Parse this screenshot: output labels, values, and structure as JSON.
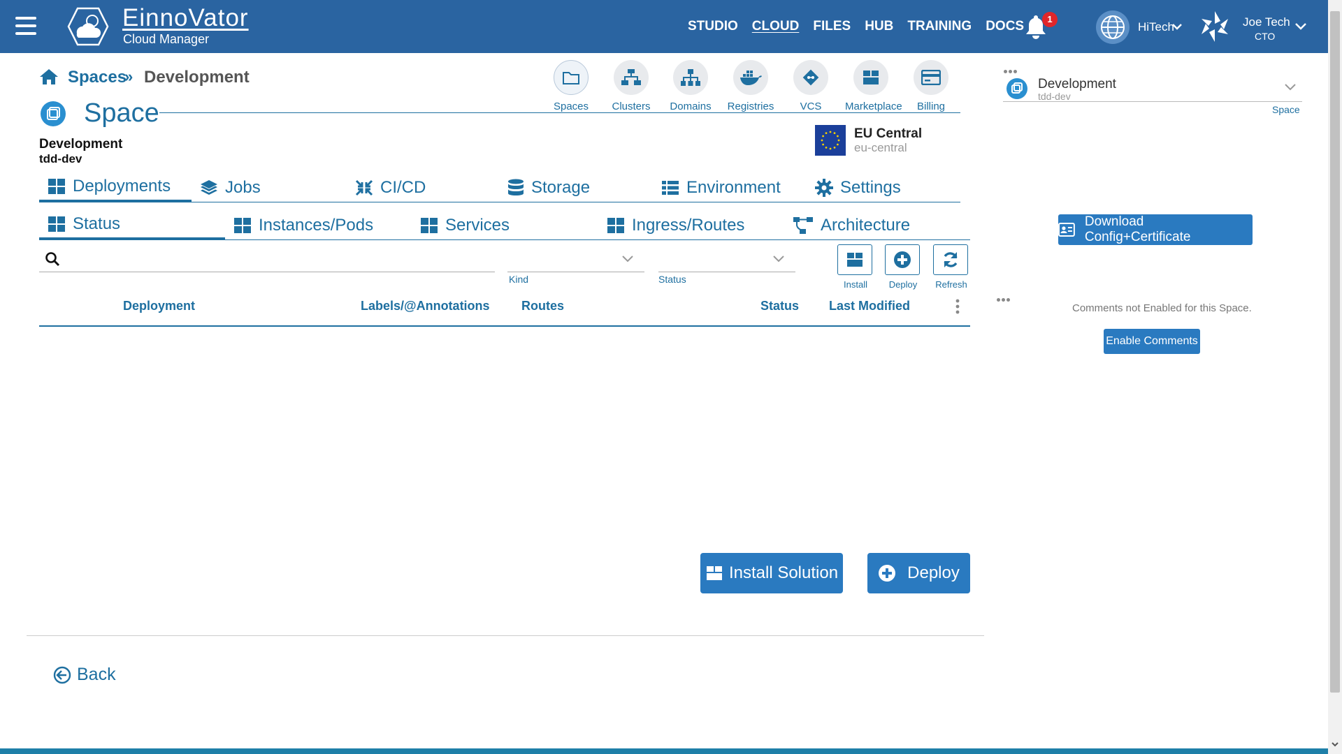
{
  "header": {
    "app_title": "EinnoVator",
    "app_subtitle": "Cloud Manager",
    "nav": [
      "STUDIO",
      "CLOUD",
      "FILES",
      "HUB",
      "TRAINING",
      "DOCS"
    ],
    "notification_count": "1",
    "org_name": "HiTech",
    "user_name": "Joe Tech",
    "user_role": "CTO"
  },
  "breadcrumb": {
    "root": "Spaces",
    "separator": "»",
    "current": "Development"
  },
  "page": {
    "title": "Space",
    "space_name": "Development",
    "space_id": "tdd-dev"
  },
  "quick_nav": [
    "Spaces",
    "Clusters",
    "Domains",
    "Registries",
    "VCS",
    "Marketplace",
    "Billing"
  ],
  "region": {
    "name": "EU Central",
    "code": "eu-central"
  },
  "main_tabs": [
    "Deployments",
    "Jobs",
    "CI/CD",
    "Storage",
    "Environment",
    "Settings"
  ],
  "sub_tabs": [
    "Status",
    "Instances/Pods",
    "Services",
    "Ingress/Routes",
    "Architecture"
  ],
  "filters": {
    "search_placeholder": "",
    "kind_label": "Kind",
    "status_label": "Status"
  },
  "toolbar": {
    "install": "Install",
    "deploy": "Deploy",
    "refresh": "Refresh"
  },
  "table": {
    "columns": [
      "Deployment",
      "Labels/@Annotations",
      "Routes",
      "Status",
      "Last Modified"
    ],
    "rows": []
  },
  "actions": {
    "install_solution": "Install Solution",
    "deploy": "Deploy",
    "back": "Back"
  },
  "right_panel": {
    "space_name": "Development",
    "space_id": "tdd-dev",
    "select_label": "Space",
    "download_button": "Download Config+Certificate",
    "comments_message": "Comments not Enabled for this Space.",
    "enable_comments_button": "Enable Comments"
  },
  "colors": {
    "header_bg": "#2a64a1",
    "primary": "#1e6fa0",
    "button": "#2a7ac0",
    "badge": "#e0262a"
  }
}
